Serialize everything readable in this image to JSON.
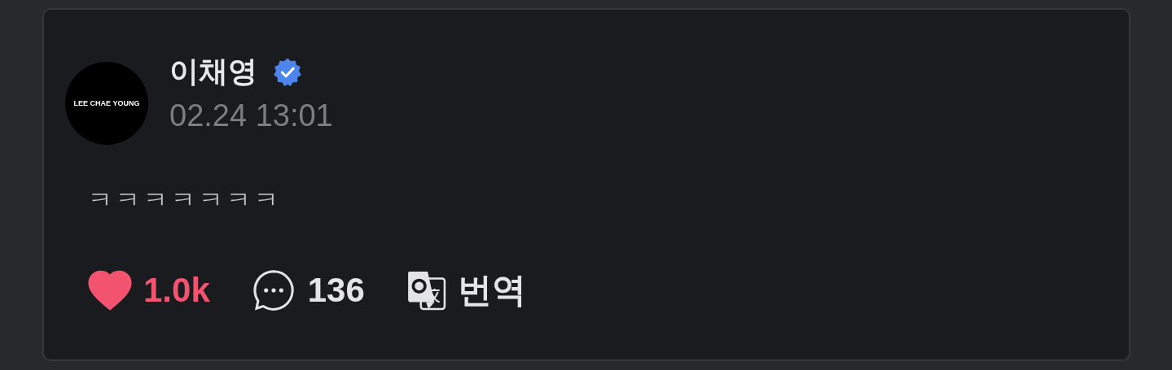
{
  "post": {
    "avatar_text": "LEE CHAE YOUNG",
    "author": "이채영",
    "verified": true,
    "time": "02.24 13:01",
    "body": "ㅋㅋㅋㅋㅋㅋㅋ",
    "actions": [
      {
        "kind": "like",
        "label": "1.0k",
        "liked": true
      },
      {
        "kind": "comment",
        "label": "136"
      },
      {
        "kind": "translate",
        "label": "번역"
      }
    ]
  }
}
